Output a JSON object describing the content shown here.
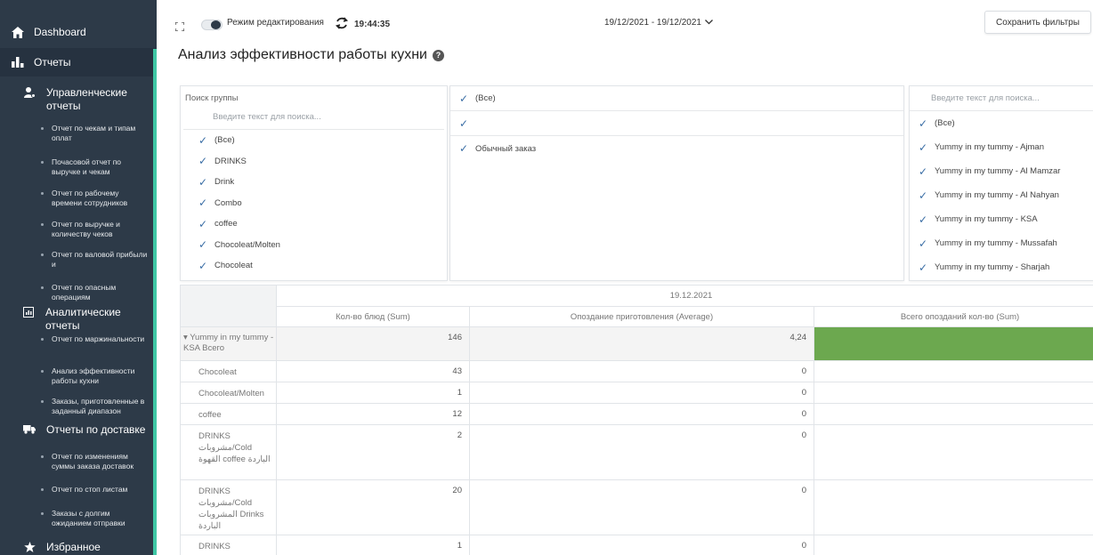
{
  "sidebar": {
    "dashboard": "Dashboard",
    "reports": "Отчеты",
    "groups": [
      {
        "label": "Управленческие отчеты",
        "items": [
          "Отчет по чекам и типам оплат",
          "Почасовой отчет по выручке и чекам",
          "Отчет по рабочему времени сотрудников",
          "Отчет по выручке и количеству чеков",
          "Отчет по валовой прибыли и",
          "Отчет по опасным операциям"
        ]
      },
      {
        "label": "Аналитические отчеты",
        "items": [
          "Отчет по маржинальности",
          "Анализ эффективности работы кухни",
          "Заказы, приготовленные в заданный диапазон"
        ]
      },
      {
        "label": "Отчеты по доставке",
        "items": [
          "Отчет по изменениям суммы заказа доставок",
          "Отчет по стоп листам",
          "Заказы с долгим ожиданием отправки"
        ]
      }
    ],
    "favorites": "Избранное",
    "accent_color": "#3ec7a4"
  },
  "topbar": {
    "edit_mode_label": "Режим редактирования",
    "time": "19:44:35",
    "date_range": "19/12/2021 - 19/12/2021",
    "save_filters": "Сохранить фильтры"
  },
  "page_title": "Анализ эффективности работы кухни",
  "filters": {
    "groups": {
      "title": "Поиск группы",
      "placeholder": "Введите текст для поиска...",
      "items": [
        "(Все)",
        "DRINKS",
        "Drink",
        "Combo",
        "coffee",
        "Chocoleat/Molten",
        "Chocoleat"
      ]
    },
    "order_types": {
      "items": [
        "(Все)",
        "",
        "Обычный заказ"
      ]
    },
    "restaurants": {
      "placeholder": "Введите текст для поиска...",
      "items": [
        "(Все)",
        "Yummy in my tummy - Ajman",
        "Yummy in my tummy - Al Mamzar",
        "Yummy in my tummy - Al Nahyan",
        "Yummy in my tummy - KSA",
        "Yummy in my tummy - Mussafah",
        "Yummy in my tummy - Sharjah"
      ]
    }
  },
  "pivot": {
    "date": "19.12.2021",
    "columns": [
      "Кол-во блюд (Sum)",
      "Опоздание приготовления (Average)",
      "Всего опозданий кол-во (Sum)"
    ],
    "total_row": {
      "label": "Yummy in my tummy - KSA Всего",
      "qty": "146",
      "delay": "4,24",
      "late": "",
      "late_color": "#6ca84f"
    },
    "rows": [
      {
        "label": "Chocoleat",
        "qty": "43",
        "delay": "0"
      },
      {
        "label": "Chocoleat/Molten",
        "qty": "1",
        "delay": "0"
      },
      {
        "label": "coffee",
        "qty": "12",
        "delay": "0"
      },
      {
        "label": "DRINKS مشروبات/Cold القهوة coffee الباردة",
        "qty": "2",
        "delay": "0"
      },
      {
        "label": "DRINKS مشروبات/Cold المشروبات Drinks الباردة",
        "qty": "20",
        "delay": "0"
      },
      {
        "label": "DRINKS",
        "qty": "1",
        "delay": "0"
      }
    ]
  }
}
